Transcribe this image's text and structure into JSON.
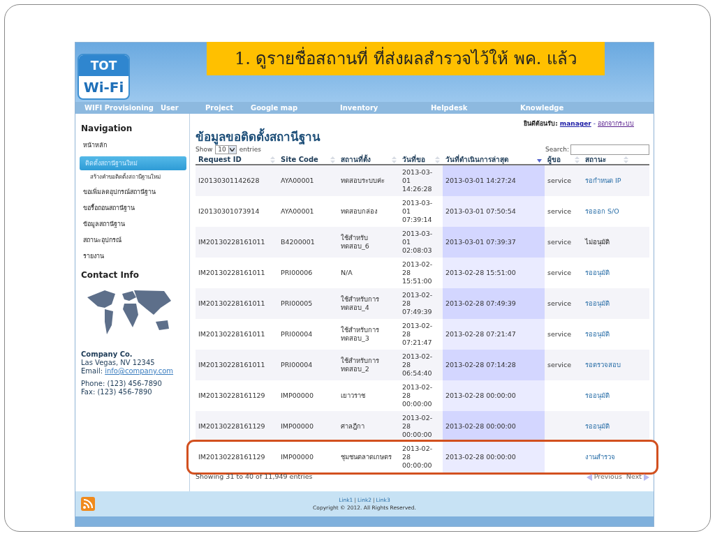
{
  "callout": "1. ดูรายชื่อสถานที่ ที่ส่งผลสำรวจไว้ให้ พค. แล้ว",
  "logo": {
    "top": "TOT",
    "bottom": "Wi-Fi"
  },
  "menu": [
    "WIFI Provisioning",
    "User",
    "Project",
    "Google map",
    "Inventory",
    "Helpdesk",
    "Knowledge"
  ],
  "sidebar": {
    "title": "Navigation",
    "items": [
      {
        "label": "หน้าหลัก",
        "selected": false
      },
      {
        "label": "ติดตั้งสถานีฐานใหม่",
        "selected": true,
        "children": [
          {
            "label": "สร้างคำขอติดตั้งสถานีฐานใหม่",
            "selected": false
          }
        ]
      },
      {
        "label": "ขอเพิ่มลดอุปกรณ์สถานีฐาน",
        "selected": false
      },
      {
        "label": "ขอรื้อถอนสถานีฐาน",
        "selected": false
      },
      {
        "label": "ข้อมูลสถานีฐาน",
        "selected": false
      },
      {
        "label": "สถานะอุปกรณ์",
        "selected": false
      },
      {
        "label": "รายงาน",
        "selected": false
      }
    ],
    "contact_title": "Contact Info",
    "company": "Company Co.",
    "address": "Las Vegas, NV 12345",
    "email_label": "Email:",
    "email": "info@company.com",
    "phone": "Phone: (123) 456-7890",
    "fax": "Fax: (123) 456-7890"
  },
  "welcome": {
    "label": "ยินดีต้อนรับ:",
    "user": "manager",
    "separator": "-",
    "logout": "ออกจากระบบ"
  },
  "page_title": "ข้อมูลขอติดตั้งสถานีฐาน",
  "length": {
    "before": "Show",
    "value": "10",
    "after": "entries"
  },
  "search": {
    "label": "Search:"
  },
  "table": {
    "columns": [
      {
        "label": "Request ID",
        "sorted": false
      },
      {
        "label": "Site Code",
        "sorted": false
      },
      {
        "label": "สถานที่ตั้ง",
        "sorted": false
      },
      {
        "label": "วันที่ขอ",
        "sorted": false
      },
      {
        "label": "วันที่ดำเนินการล่าสุด",
        "sorted": true
      },
      {
        "label": "ผู้ขอ",
        "sorted": false
      },
      {
        "label": "สถานะ",
        "sorted": false
      }
    ],
    "rows": [
      {
        "cells": [
          "I20130301142628",
          "AYA00001",
          "ทดสอบระบบค่ะ",
          "2013-03-01 14:26:28",
          "2013-03-01 14:27:24",
          "service",
          "รอกำหนด IP"
        ],
        "status_link": true,
        "highlighted": false
      },
      {
        "cells": [
          "I20130301073914",
          "AYA00001",
          "ทดสอบกล่อง",
          "2013-03-01 07:39:14",
          "2013-03-01 07:50:54",
          "service",
          "รอออก S/O"
        ],
        "status_link": true,
        "highlighted": false
      },
      {
        "cells": [
          "IM20130228161011",
          "B4200001",
          "ใช้สำหรับ ทดสอบ_6",
          "2013-03-01 02:08:03",
          "2013-03-01 07:39:37",
          "service",
          "ไม่อนุมัติ"
        ],
        "status_link": false,
        "highlighted": false
      },
      {
        "cells": [
          "IM20130228161011",
          "PRI00006",
          "N/A",
          "2013-02-28 15:51:00",
          "2013-02-28 15:51:00",
          "service",
          "รออนุมัติ"
        ],
        "status_link": true,
        "highlighted": false
      },
      {
        "cells": [
          "IM20130228161011",
          "PRI00005",
          "ใช้สำหรับการ ทดสอบ_4",
          "2013-02-28 07:49:39",
          "2013-02-28 07:49:39",
          "service",
          "รออนุมัติ"
        ],
        "status_link": true,
        "highlighted": false
      },
      {
        "cells": [
          "IM20130228161011",
          "PRI00004",
          "ใช้สำหรับการ ทดสอบ_3",
          "2013-02-28 07:21:47",
          "2013-02-28 07:21:47",
          "service",
          "รออนุมัติ"
        ],
        "status_link": true,
        "highlighted": false
      },
      {
        "cells": [
          "IM20130228161011",
          "PRI00004",
          "ใช้สำหรับการ ทดสอบ_2",
          "2013-02-28 06:54:40",
          "2013-02-28 07:14:28",
          "service",
          "รอตรวจสอบ"
        ],
        "status_link": true,
        "highlighted": false
      },
      {
        "cells": [
          "IM20130228161129",
          "IMP00000",
          "เยาวราช",
          "2013-02-28 00:00:00",
          "2013-02-28 00:00:00",
          "",
          "รออนุมัติ"
        ],
        "status_link": true,
        "highlighted": false
      },
      {
        "cells": [
          "IM20130228161129",
          "IMP00000",
          "ศาลฎีกา",
          "2013-02-28 00:00:00",
          "2013-02-28 00:00:00",
          "",
          "รออนุมัติ"
        ],
        "status_link": true,
        "highlighted": false
      },
      {
        "cells": [
          "IM20130228161129",
          "IMP00000",
          "ชุมชนตลาดเกษตร",
          "2013-02-28 00:00:00",
          "2013-02-28 00:00:00",
          "",
          "งานสำรวจ"
        ],
        "status_link": true,
        "highlighted": true
      }
    ]
  },
  "info": "Showing 31 to 40 of 11,949 entries",
  "pager": [
    "Previous",
    "Next"
  ],
  "footer": {
    "links": [
      "Link1",
      "Link2",
      "Link3"
    ],
    "link_separator": "|",
    "copyright": "Copyright © 2012. All Rights Reserved."
  }
}
